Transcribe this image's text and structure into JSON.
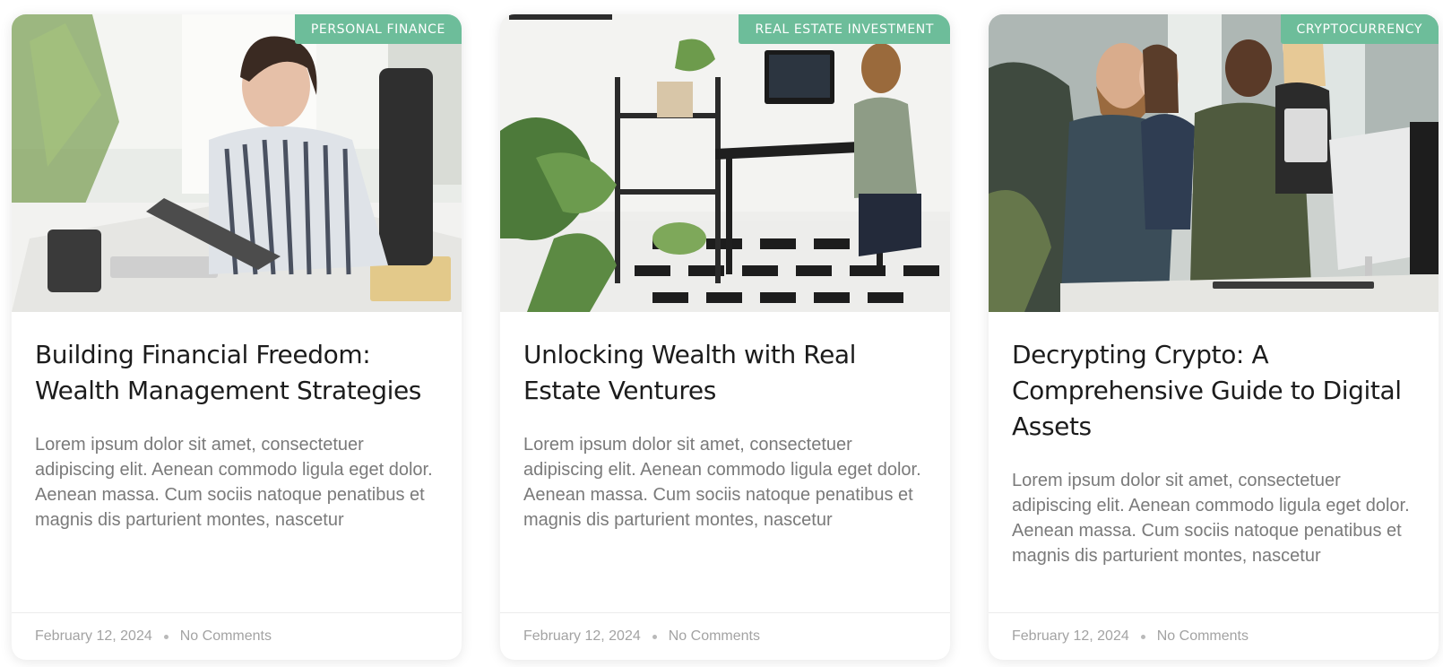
{
  "posts": [
    {
      "category": "PERSONAL FINANCE",
      "title": "Building Financial Freedom: Wealth Management Strategies",
      "excerpt": "Lorem ipsum dolor sit amet, consectetuer adipiscing elit. Aenean commodo ligula eget dolor. Aenean massa. Cum sociis natoque penatibus et magnis dis parturient montes, nascetur",
      "date": "February 12, 2024",
      "comments": "No Comments"
    },
    {
      "category": "REAL ESTATE INVESTMENT",
      "title": "Unlocking Wealth with Real Estate Ventures",
      "excerpt": "Lorem ipsum dolor sit amet, consectetuer adipiscing elit. Aenean commodo ligula eget dolor. Aenean massa. Cum sociis natoque penatibus et magnis dis parturient montes, nascetur",
      "date": "February 12, 2024",
      "comments": "No Comments"
    },
    {
      "category": "CRYPTOCURRENCY",
      "title": "Decrypting Crypto: A Comprehensive Guide to Digital Assets",
      "excerpt": "Lorem ipsum dolor sit amet, consectetuer adipiscing elit. Aenean commodo ligula eget dolor. Aenean massa. Cum sociis natoque penatibus et magnis dis parturient montes, nascetur",
      "date": "February 12, 2024",
      "comments": "No Comments"
    }
  ],
  "colors": {
    "badge": "#6dbd9a",
    "title": "#1c1c1c",
    "excerpt": "#7a7a7a",
    "meta": "#a3a3a3"
  }
}
